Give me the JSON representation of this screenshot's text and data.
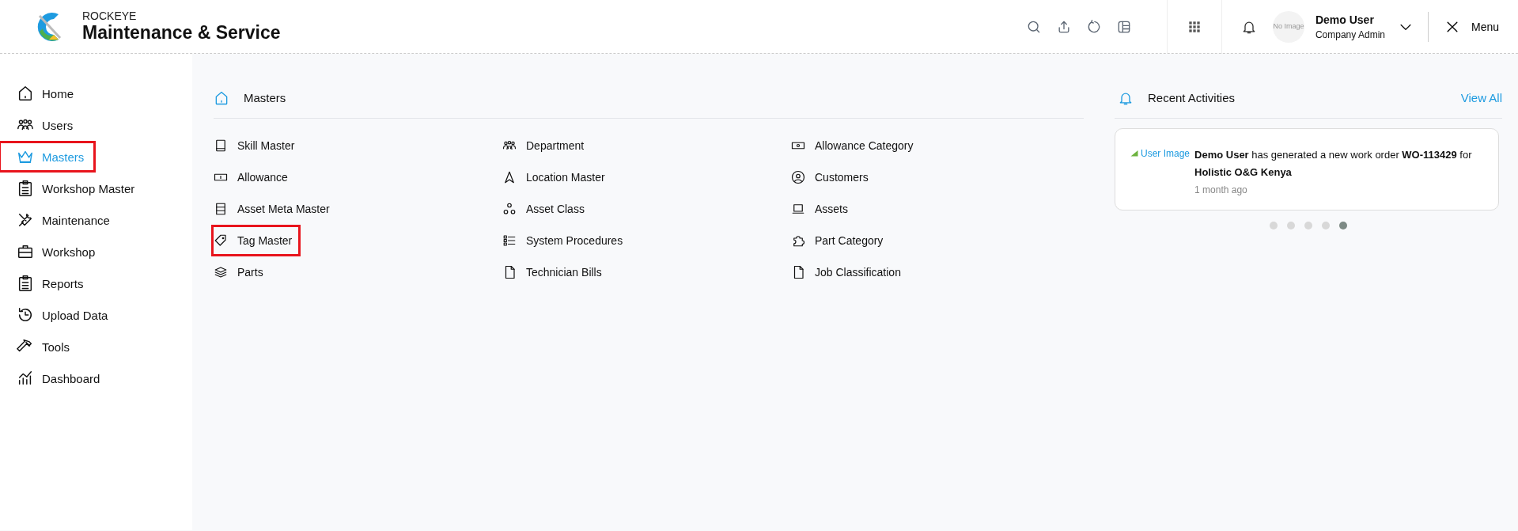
{
  "header": {
    "brand_top": "ROCKEYE",
    "brand_title": "Maintenance & Service",
    "avatar_text": "No Image",
    "user_name": "Demo User",
    "user_role": "Company Admin",
    "menu_label": "Menu"
  },
  "sidebar": {
    "items": [
      {
        "label": "Home",
        "selected": false,
        "highlighted": false
      },
      {
        "label": "Users",
        "selected": false,
        "highlighted": false
      },
      {
        "label": "Masters",
        "selected": true,
        "highlighted": true
      },
      {
        "label": "Workshop Master",
        "selected": false,
        "highlighted": false
      },
      {
        "label": "Maintenance",
        "selected": false,
        "highlighted": false
      },
      {
        "label": "Workshop",
        "selected": false,
        "highlighted": false
      },
      {
        "label": "Reports",
        "selected": false,
        "highlighted": false
      },
      {
        "label": "Upload Data",
        "selected": false,
        "highlighted": false
      },
      {
        "label": "Tools",
        "selected": false,
        "highlighted": false
      },
      {
        "label": "Dashboard",
        "selected": false,
        "highlighted": false
      }
    ]
  },
  "masters": {
    "title": "Masters",
    "columns": [
      [
        {
          "label": "Skill Master",
          "highlighted": false
        },
        {
          "label": "Allowance",
          "highlighted": false
        },
        {
          "label": "Asset Meta Master",
          "highlighted": false
        },
        {
          "label": "Tag Master",
          "highlighted": true
        },
        {
          "label": "Parts",
          "highlighted": false
        }
      ],
      [
        {
          "label": "Department",
          "highlighted": false
        },
        {
          "label": "Location Master",
          "highlighted": false
        },
        {
          "label": "Asset Class",
          "highlighted": false
        },
        {
          "label": "System Procedures",
          "highlighted": false
        },
        {
          "label": "Technician Bills",
          "highlighted": false
        }
      ],
      [
        {
          "label": "Allowance Category",
          "highlighted": false
        },
        {
          "label": "Customers",
          "highlighted": false
        },
        {
          "label": "Assets",
          "highlighted": false
        },
        {
          "label": "Part Category",
          "highlighted": false
        },
        {
          "label": "Job Classification",
          "highlighted": false
        }
      ]
    ]
  },
  "recent_activities": {
    "title": "Recent Activities",
    "view_all": "View All",
    "activity": {
      "image_alt": "User Image",
      "message": "**Demo User** has generated a new work order **WO-113429** for **Holistic O&G Kenya**",
      "time": "1 month ago"
    },
    "dots": [
      {
        "selected": false
      },
      {
        "selected": false
      },
      {
        "selected": false
      },
      {
        "selected": false
      },
      {
        "selected": true
      }
    ]
  }
}
